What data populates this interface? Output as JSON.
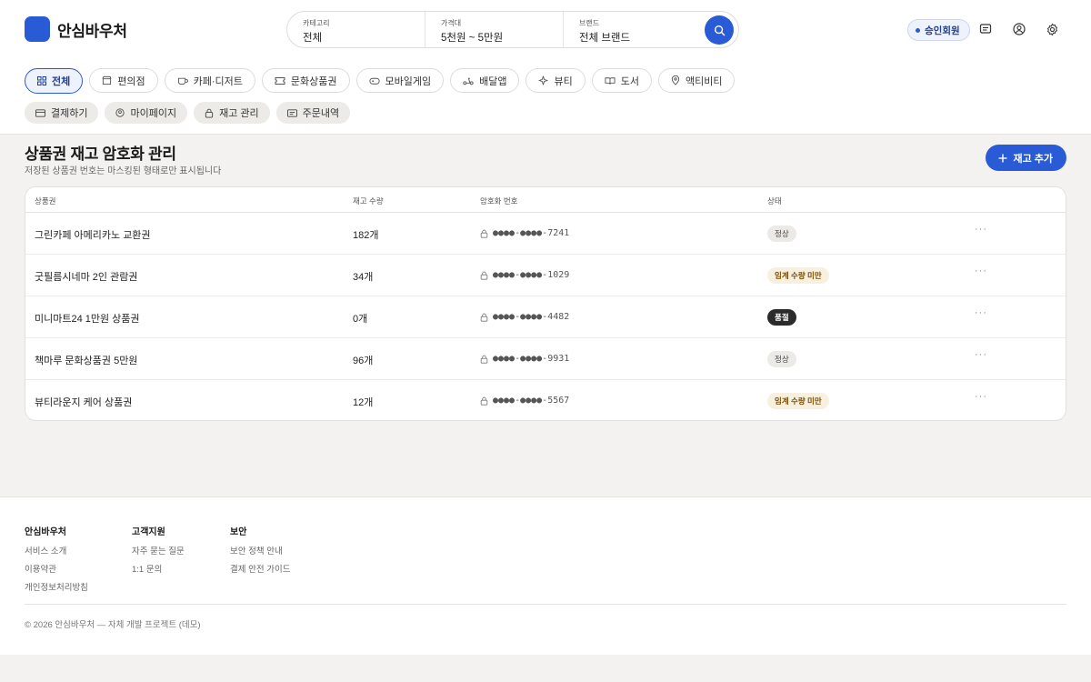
{
  "brand": {
    "name": "안심바우처",
    "accent": "#2a5bd7"
  },
  "search": {
    "category": {
      "label": "카테고리",
      "value": "전체"
    },
    "price": {
      "label": "가격대",
      "value": "5천원 ~ 5만원"
    },
    "brand": {
      "label": "브랜드",
      "value": "전체 브랜드"
    },
    "button_icon": "search-icon"
  },
  "header": {
    "member_badge": "승인회원",
    "icons": [
      "chat-icon",
      "user-icon",
      "settings-icon"
    ]
  },
  "categories": [
    {
      "label": "전체",
      "icon": "grid-icon",
      "active": true
    },
    {
      "label": "편의점",
      "icon": "store-icon"
    },
    {
      "label": "카페·디저트",
      "icon": "cup-icon"
    },
    {
      "label": "문화상품권",
      "icon": "ticket-icon"
    },
    {
      "label": "모바일게임",
      "icon": "gamepad-icon"
    },
    {
      "label": "배달앱",
      "icon": "scooter-icon"
    },
    {
      "label": "뷰티",
      "icon": "sparkle-icon"
    },
    {
      "label": "도서",
      "icon": "book-icon"
    },
    {
      "label": "액티비티",
      "icon": "pin-icon"
    }
  ],
  "nav": [
    {
      "label": "결제하기",
      "icon": "card-icon"
    },
    {
      "label": "마이페이지",
      "icon": "user-icon"
    },
    {
      "label": "재고 관리",
      "icon": "lock-icon"
    },
    {
      "label": "주문내역",
      "icon": "receipt-icon"
    }
  ],
  "page": {
    "title": "상품권 재고 암호화 관리",
    "subtitle": "저장된 상품권 번호는 마스킹된 형태로만 표시됩니다",
    "add_button": "재고 추가"
  },
  "table": {
    "columns": [
      "상품권",
      "재고 수량",
      "암호화 번호",
      "상태"
    ],
    "rows": [
      {
        "name": "그린카페 아메리카노 교환권",
        "qty": "182개",
        "code": "●●●●-●●●●-7241",
        "status": "정상",
        "status_type": "ok",
        "more": "···"
      },
      {
        "name": "굿필름시네마 2인 관람권",
        "qty": "34개",
        "code": "●●●●-●●●●-1029",
        "status": "임계 수량 미만",
        "status_type": "warn",
        "more": "···"
      },
      {
        "name": "미니마트24 1만원 상품권",
        "qty": "0개",
        "code": "●●●●-●●●●-4482",
        "status": "품절",
        "status_type": "out",
        "more": "···"
      },
      {
        "name": "책마루 문화상품권 5만원",
        "qty": "96개",
        "code": "●●●●-●●●●-9931",
        "status": "정상",
        "status_type": "ok",
        "more": "···"
      },
      {
        "name": "뷰티라운지 케어 상품권",
        "qty": "12개",
        "code": "●●●●-●●●●-5567",
        "status": "임계 수량 미만",
        "status_type": "warn",
        "more": "···"
      }
    ]
  },
  "footer": {
    "columns": [
      {
        "title": "안심바우처",
        "links": [
          "서비스 소개",
          "이용약관",
          "개인정보처리방침"
        ]
      },
      {
        "title": "고객지원",
        "links": [
          "자주 묻는 질문",
          "1:1 문의"
        ]
      },
      {
        "title": "보안",
        "links": [
          "보안 정책 안내",
          "결제 안전 가이드"
        ]
      }
    ],
    "copyright": "© 2026 안심바우처 — 자체 개발 프로젝트 (데모)"
  }
}
